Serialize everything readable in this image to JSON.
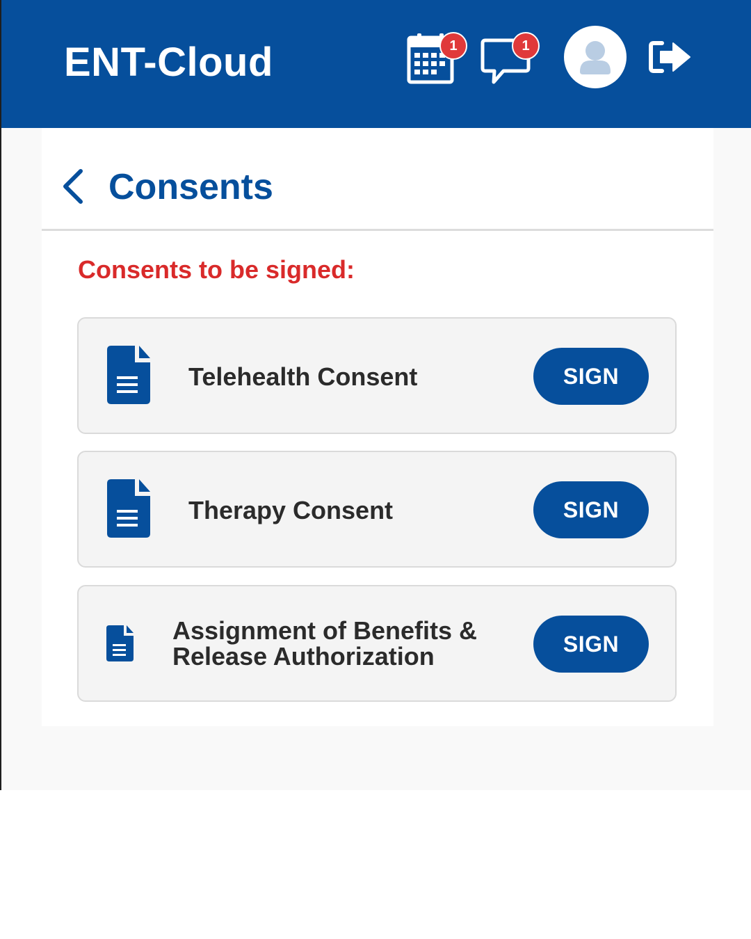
{
  "app": {
    "title": "ENT-Cloud"
  },
  "header": {
    "calendar": {
      "icon": "calendar-icon",
      "badge_count": "1"
    },
    "messages": {
      "icon": "chat-bubble-icon",
      "badge_count": "1"
    },
    "avatar": {
      "icon": "user-avatar-icon"
    },
    "logout": {
      "icon": "logout-icon"
    }
  },
  "page": {
    "back_icon": "chevron-left-icon",
    "title": "Consents",
    "section_heading": "Consents to be signed:"
  },
  "consents": [
    {
      "icon": "document-icon",
      "name": "Telehealth Consent",
      "action_label": "SIGN"
    },
    {
      "icon": "document-icon",
      "name": "Therapy Consent",
      "action_label": "SIGN"
    },
    {
      "icon": "document-icon",
      "name": "Assignment of Benefits & Release Authorization",
      "action_label": "SIGN"
    }
  ],
  "colors": {
    "primary": "#064f9c",
    "alert": "#d92a2a",
    "badge": "#e0393a",
    "card_background": "#f4f4f4",
    "text": "#2b2b2b"
  }
}
